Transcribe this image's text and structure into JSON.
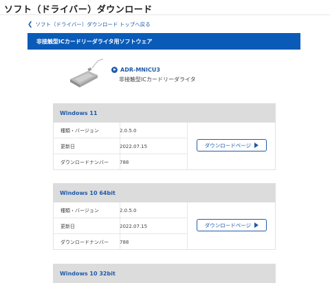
{
  "page": {
    "title": "ソフト（ドライバー）ダウンロード",
    "back_link": "ソフト（ドライバー）ダウンロード トップへ戻る"
  },
  "section": {
    "title": "非接触型ICカードリーダライタ用ソフトウェア"
  },
  "product": {
    "name": "ADR-MNICU3",
    "description": "非接触型ICカードリーダライタ"
  },
  "os_blocks": [
    {
      "os": "Windows 11",
      "rows": [
        {
          "label": "種類・バージョン",
          "value": "2.0.5.0"
        },
        {
          "label": "更新日",
          "value": "2022.07.15"
        },
        {
          "label": "ダウンロードナンバー",
          "value": "788"
        }
      ],
      "button_label": "ダウンロードページ"
    },
    {
      "os": "Windows 10 64bit",
      "rows": [
        {
          "label": "種類・バージョン",
          "value": "2.0.5.0"
        },
        {
          "label": "更新日",
          "value": "2022.07.15"
        },
        {
          "label": "ダウンロードナンバー",
          "value": "788"
        }
      ],
      "button_label": "ダウンロードページ"
    },
    {
      "os": "Windows 10 32bit"
    }
  ],
  "colors": {
    "brand_blue": "#0a5bb8",
    "link_blue": "#1e5aa8",
    "header_gray": "#dcdcdc"
  }
}
